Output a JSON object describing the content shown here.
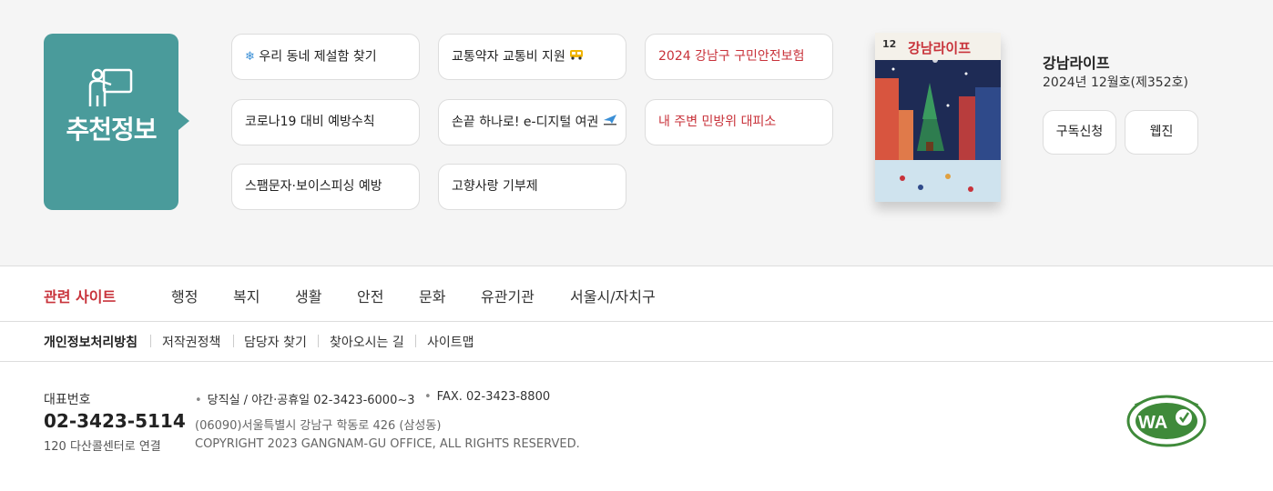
{
  "recommend": {
    "title": "추천정보",
    "links": [
      {
        "label": "우리 동네 제설함 찾기",
        "icon": "snowflake-icon"
      },
      {
        "label": "교통약자 교통비 지원",
        "icon": "bus-icon"
      },
      {
        "label": "2024 강남구 구민안전보험"
      },
      {
        "label": "코로나19 대비 예방수칙"
      },
      {
        "label": "손끝 하나로! e-디지털 여권",
        "icon": "airplane-icon"
      },
      {
        "label": "내 주변 민방위 대피소"
      },
      {
        "label": "스팸문자·보이스피싱 예방"
      },
      {
        "label": "고향사랑 기부제"
      }
    ]
  },
  "magazine": {
    "cover_month": "12",
    "cover_title": "강남라이프",
    "title": "강남라이프",
    "issue": "2024년 12월호(제352호)",
    "subscribe_label": "구독신청",
    "webzine_label": "웹진"
  },
  "sites": {
    "label": "관련 사이트",
    "items": [
      "행정",
      "복지",
      "생활",
      "안전",
      "문화",
      "유관기관",
      "서울시/자치구"
    ]
  },
  "policy": {
    "items": [
      "개인정보처리방침",
      "저작권정책",
      "담당자 찾기",
      "찾아오시는 길",
      "사이트맵"
    ]
  },
  "footer": {
    "phone_label": "대표번호",
    "phone": "02-3423-5114",
    "phone_sub": "120 다산콜센터로 연결",
    "night_line": "당직실 / 야간·공휴일 02-3423-6000~3",
    "fax_line": "FAX. 02-3423-8800",
    "address": "(06090)서울특별시 강남구 학동로 426 (삼성동)",
    "copyright": "COPYRIGHT 2023 GANGNAM-GU OFFICE, ALL RIGHTS RESERVED."
  },
  "colors": {
    "accent_teal": "#4a9b9b",
    "highlight_red": "#c8323a"
  }
}
